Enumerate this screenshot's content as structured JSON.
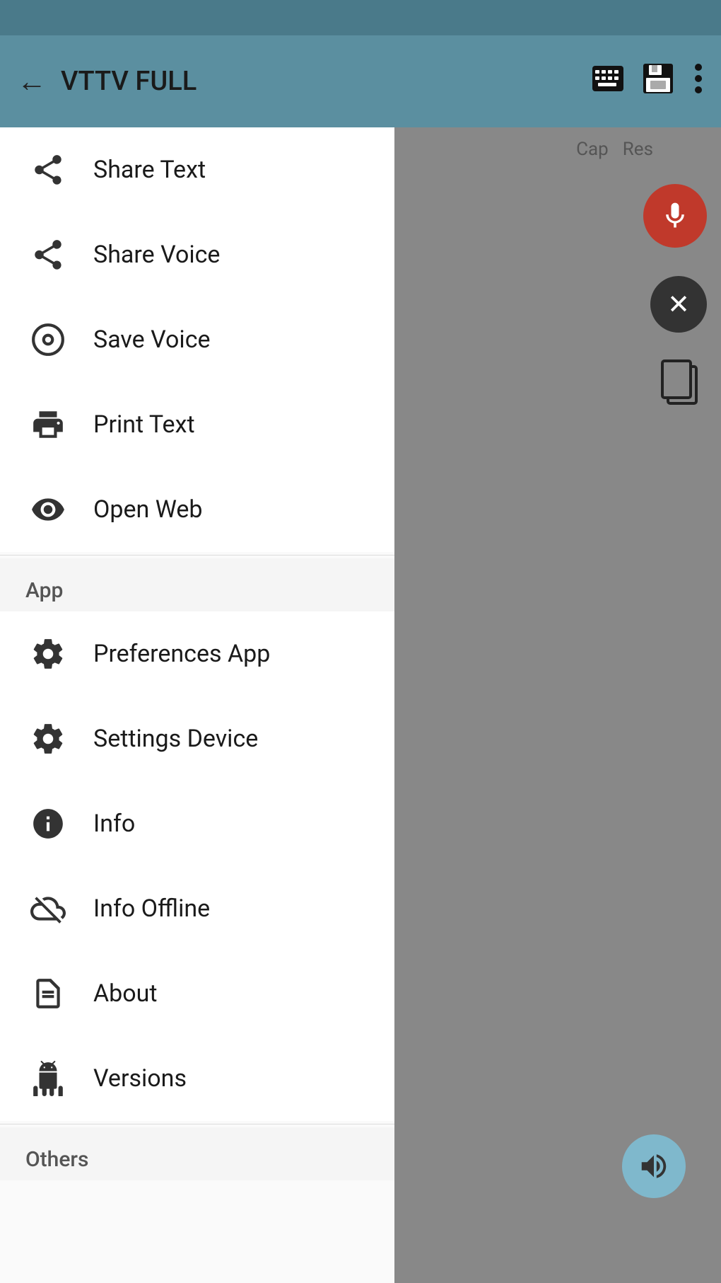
{
  "app": {
    "title": "VTTV FULL",
    "back_label": "←"
  },
  "toolbar": {
    "keyboard_icon": "keyboard-icon",
    "save_icon": "save-icon",
    "more_icon": "more-icon"
  },
  "tabs": {
    "cap_label": "Cap",
    "res_label": "Res"
  },
  "menu": {
    "section_share": "",
    "items_share": [
      {
        "id": "share-text",
        "label": "Share Text",
        "icon": "share-icon"
      },
      {
        "id": "share-voice",
        "label": "Share Voice",
        "icon": "share-icon"
      },
      {
        "id": "save-voice",
        "label": "Save Voice",
        "icon": "record-icon"
      },
      {
        "id": "print-text",
        "label": "Print Text",
        "icon": "print-icon"
      },
      {
        "id": "open-web",
        "label": "Open Web",
        "icon": "eye-icon"
      }
    ],
    "section_app": "App",
    "items_app": [
      {
        "id": "preferences-app",
        "label": "Preferences App",
        "icon": "gear-badge-icon"
      },
      {
        "id": "settings-device",
        "label": "Settings Device",
        "icon": "settings-icon"
      },
      {
        "id": "info",
        "label": "Info",
        "icon": "info-icon"
      },
      {
        "id": "info-offline",
        "label": "Info Offline",
        "icon": "cloud-off-icon"
      },
      {
        "id": "about",
        "label": "About",
        "icon": "document-icon"
      },
      {
        "id": "versions",
        "label": "Versions",
        "icon": "android-icon"
      }
    ],
    "section_others": "Others"
  }
}
